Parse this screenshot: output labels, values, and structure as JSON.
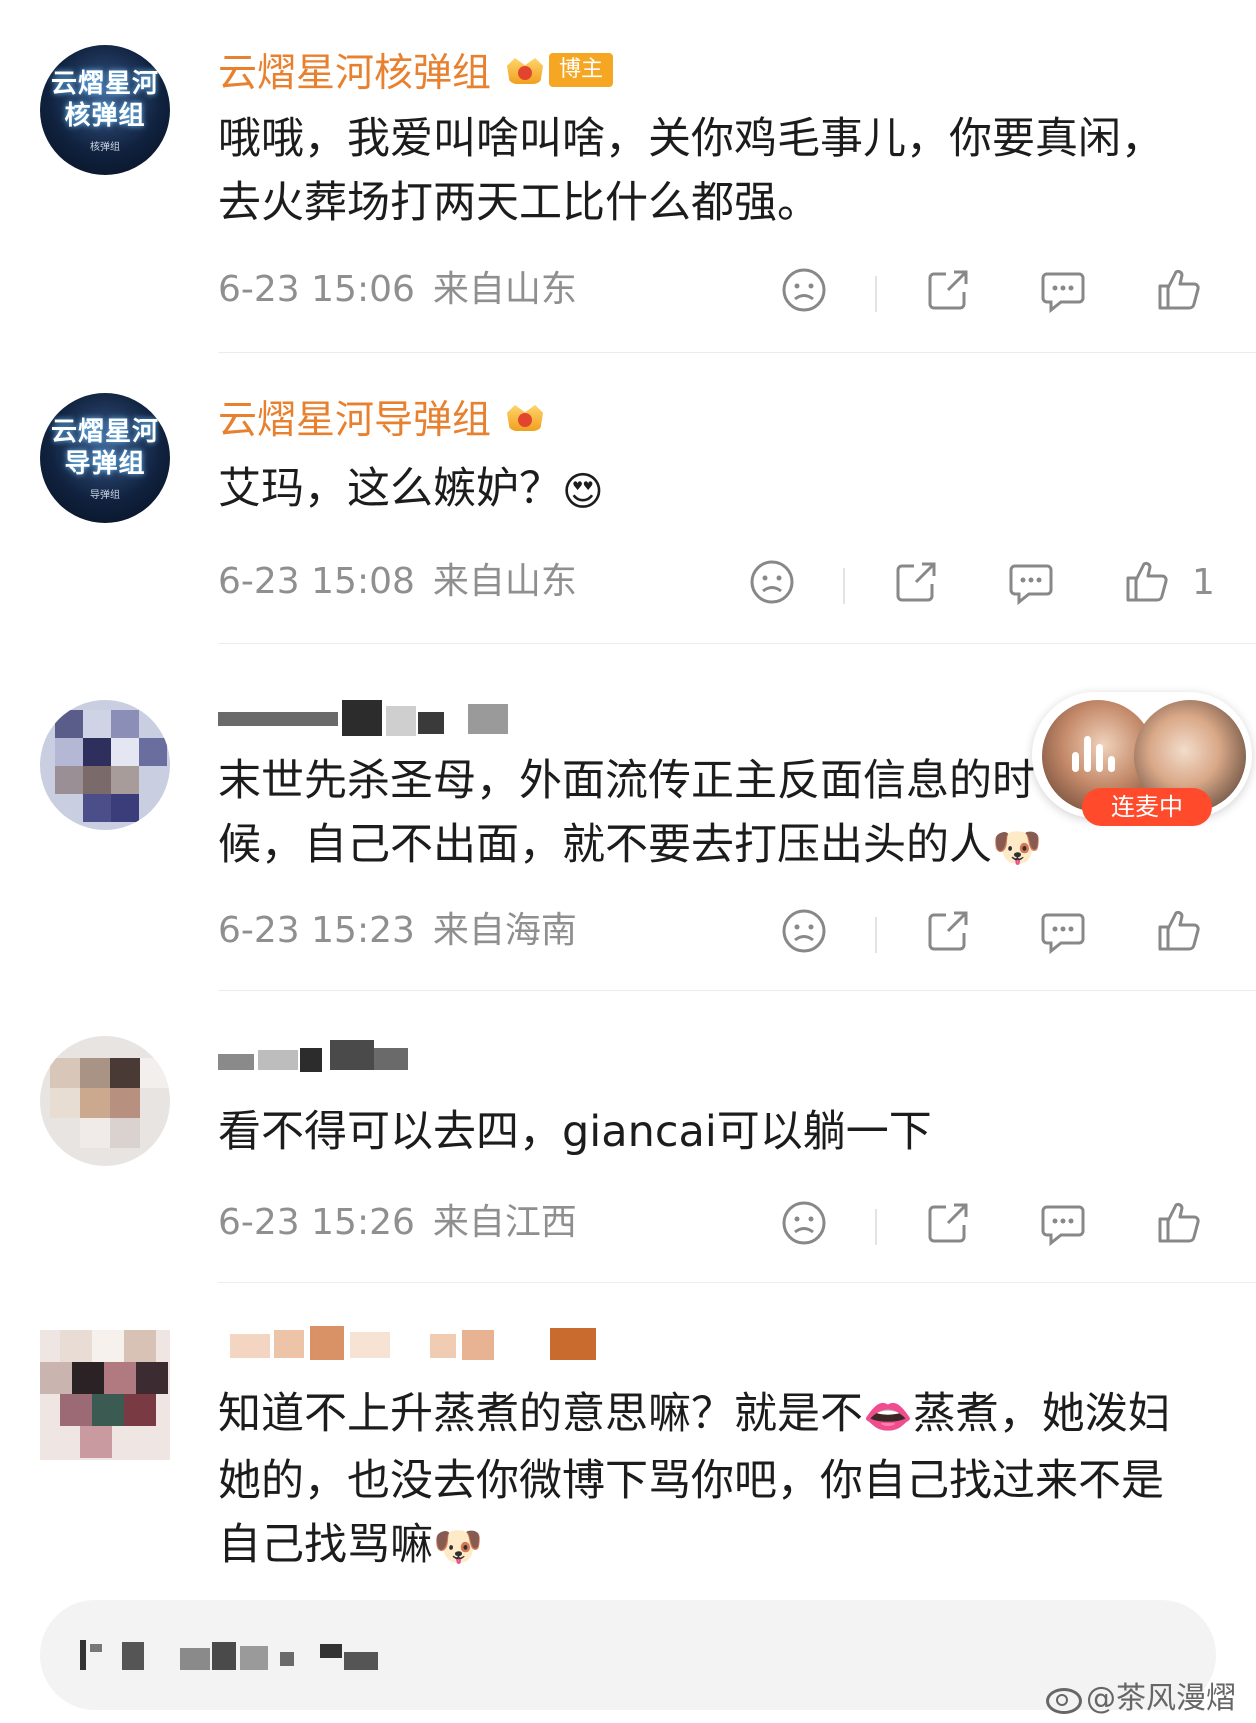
{
  "comments": [
    {
      "username": "云熠星河核弹组",
      "badge": "博主",
      "avatar_text": [
        "云熠星河",
        "核弹组"
      ],
      "avatar_sub": "核弹组",
      "text": "哦哦，我爱叫啥叫啥，关你鸡毛事儿，你要真闲，去火葬场打两天工比什么都强。",
      "time": "6-23 15:06",
      "location": "来自山东",
      "like_count": ""
    },
    {
      "username": "云熠星河导弹组",
      "avatar_text": [
        "云熠星河",
        "导弹组"
      ],
      "avatar_sub": "导弹组",
      "text": "艾玛，这么嫉妒？",
      "emoji": "😍",
      "time": "6-23 15:08",
      "location": "来自山东",
      "like_count": "1"
    },
    {
      "username": "",
      "text": "末世先杀圣母，外面流传正主反面信息的时候，自己不出面，就不要去打压出头的人",
      "emoji": "🐶",
      "time": "6-23 15:23",
      "location": "来自海南",
      "like_count": ""
    },
    {
      "username": "",
      "text": "看不得可以去四，giancai可以躺一下",
      "time": "6-23 15:26",
      "location": "来自江西",
      "like_count": ""
    },
    {
      "username": "",
      "text_part1": "知道不上升蒸煮的意思嘛？就是不",
      "emoji_mid": "👄",
      "text_part2": "蒸煮，她泼妇她的，也没去你微博下骂你吧，你自己找过来不是自己找骂嘛",
      "emoji": "🐶"
    }
  ],
  "live_widget": {
    "tag": "连麦中"
  },
  "watermark": "@茶风漫熠",
  "icons": [
    "dislike-icon",
    "share-icon",
    "comment-icon",
    "like-icon"
  ],
  "colors": {
    "username": "#e8812f",
    "badge": "#f5a623",
    "meta": "#8f8f8f",
    "live_tag": "#ff4b2b"
  }
}
